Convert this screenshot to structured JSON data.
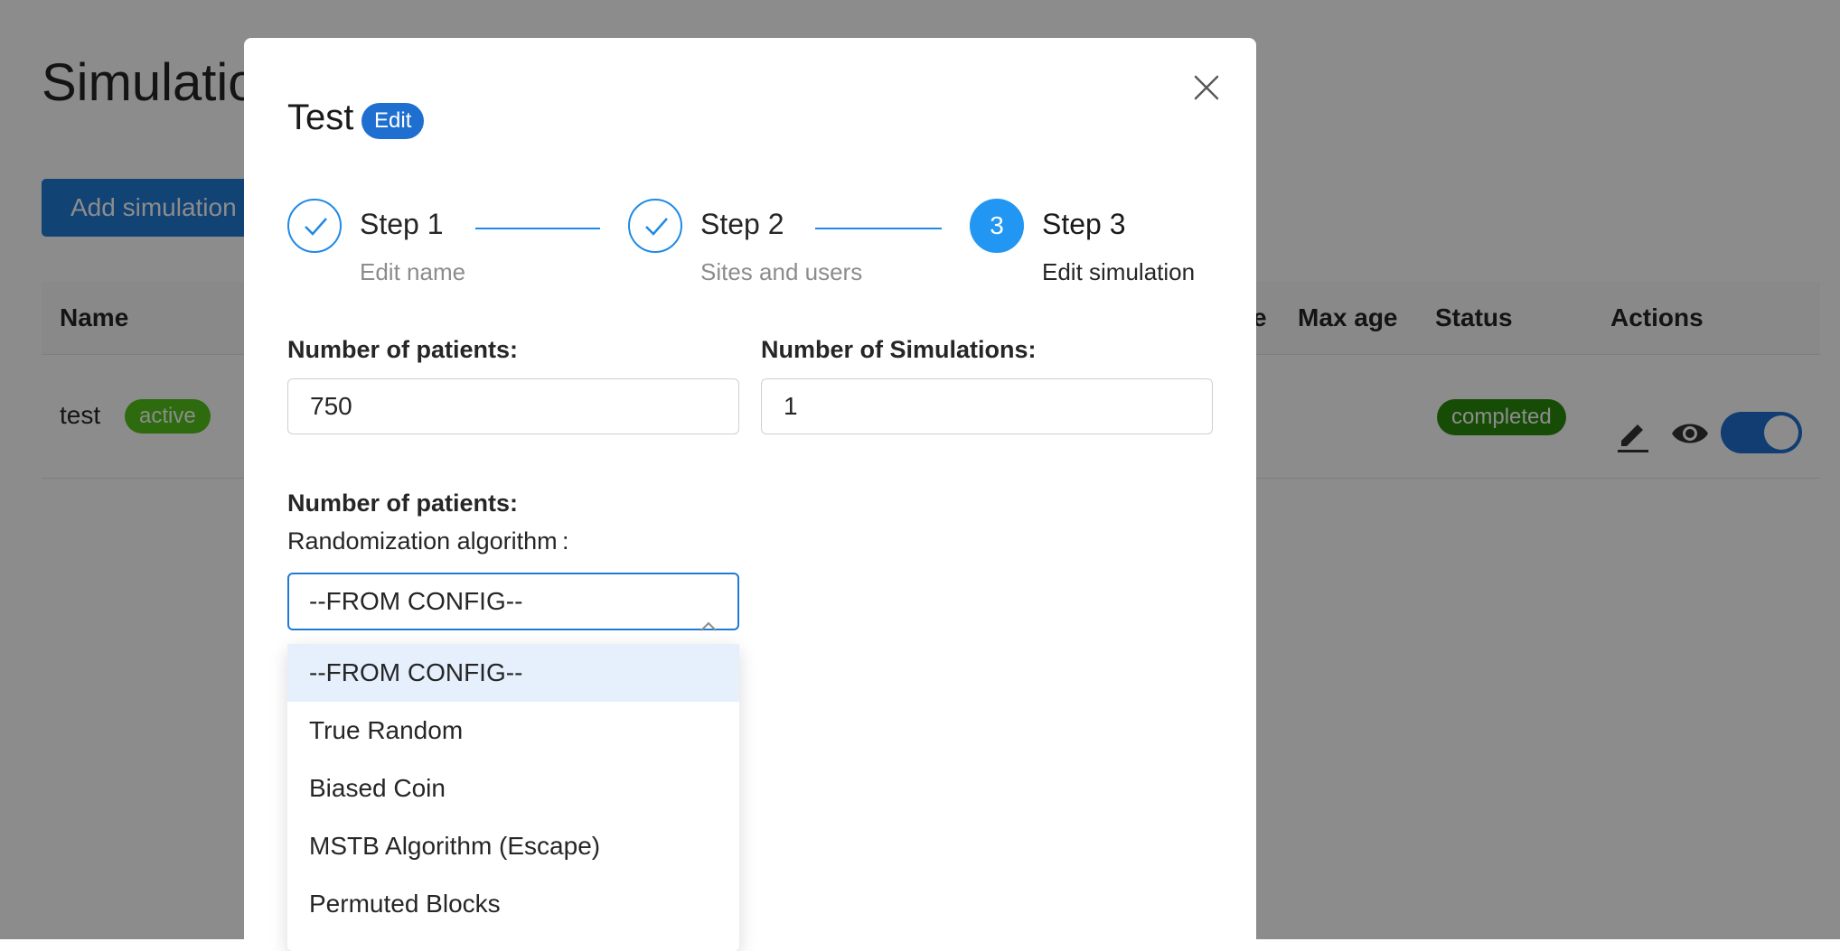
{
  "page": {
    "title": "Simulatio",
    "add_button": "Add simulation",
    "table": {
      "headers": {
        "name": "Name",
        "partial": "e",
        "max_age": "Max age",
        "status": "Status",
        "actions": "Actions"
      },
      "rows": [
        {
          "name": "test",
          "tag": "active",
          "status": "completed",
          "toggle_on": true
        }
      ]
    }
  },
  "modal": {
    "title": "Test",
    "badge": "Edit",
    "steps": [
      {
        "index": "1",
        "title": "Step 1",
        "description": "Edit name",
        "state": "done"
      },
      {
        "index": "2",
        "title": "Step 2",
        "description": "Sites and users",
        "state": "done"
      },
      {
        "index": "3",
        "title": "Step 3",
        "description": "Edit simulation",
        "state": "active"
      }
    ],
    "form": {
      "patients_label": "Number of patients:",
      "patients_value": "750",
      "simulations_label": "Number of Simulations:",
      "simulations_value": "1",
      "section_label": "Number of patients:",
      "algorithm_label": "Randomization algorithm :",
      "algorithm_selected": "--FROM CONFIG--",
      "algorithm_options": [
        "--FROM CONFIG--",
        "True Random",
        "Biased Coin",
        "MSTB Algorithm (Escape)",
        "Permuted Blocks"
      ]
    }
  },
  "colors": {
    "primary": "#1f7ad6",
    "step_active": "#2196f3",
    "tag_active": "#52c41a",
    "tag_completed": "#2a8a0e",
    "option_highlight": "#e6f0fd"
  }
}
